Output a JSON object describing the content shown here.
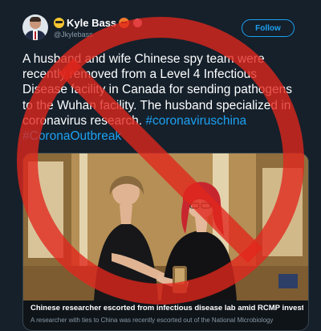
{
  "tweet": {
    "author": {
      "display_name": "Kyle Bass",
      "handle": "@Jkylebass"
    },
    "follow_label": "Follow",
    "text": "A husband and wife Chinese spy team were recently removed from a Level 4 Infectious Disease facility in Canada for sending pathogens to the Wuhan facility. The husband specialized in coronavirus research.",
    "hashtags": "#coronaviruschina #CoronaOutbreak"
  },
  "link_card": {
    "title": "Chinese researcher escorted from infectious disease lab amid RCMP investig...",
    "description": "A researcher with ties to China was recently escorted out of the National Microbiology"
  },
  "colors": {
    "background": "#15202b",
    "accent": "#1da1f2",
    "secondary_text": "#8899a6",
    "overlay_red": "#e1261c"
  },
  "icons": [
    "avatar",
    "sunglasses-emoji-icon",
    "angry-face-emoji-icon",
    "badge-icon",
    "prohibition-sign-icon"
  ]
}
